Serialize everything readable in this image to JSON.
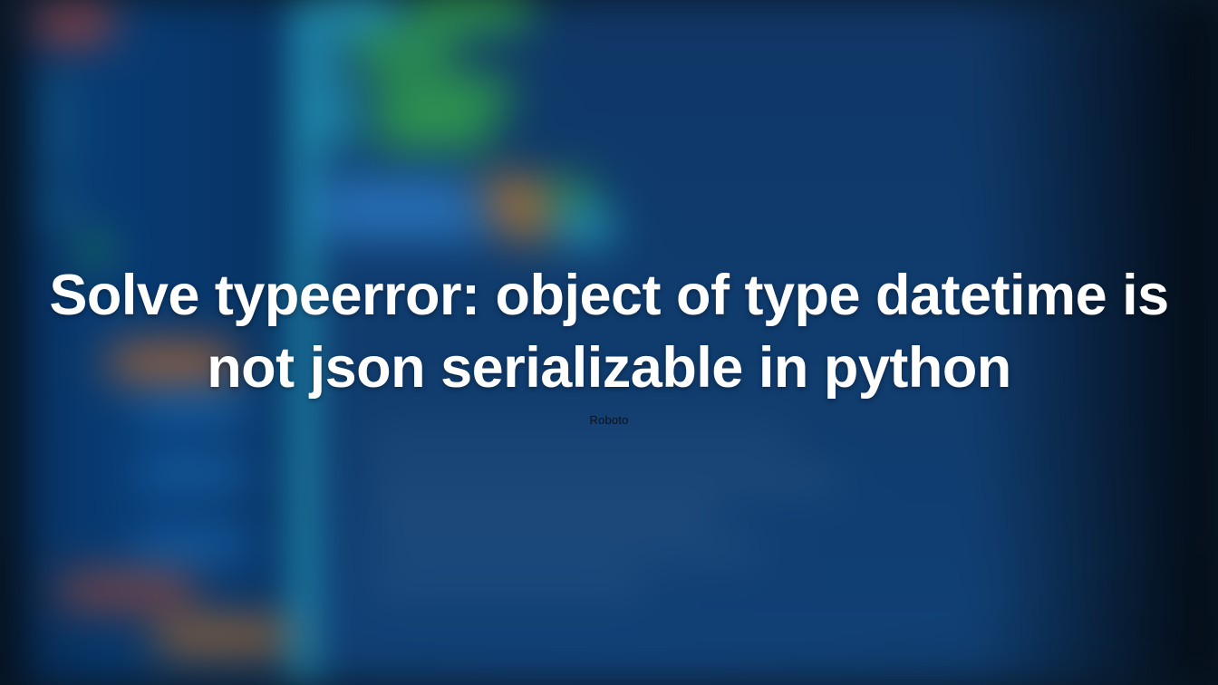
{
  "hero": {
    "headline": "Solve typeerror: object of type datetime is not json serializable in python",
    "font_label": "Roboto"
  }
}
